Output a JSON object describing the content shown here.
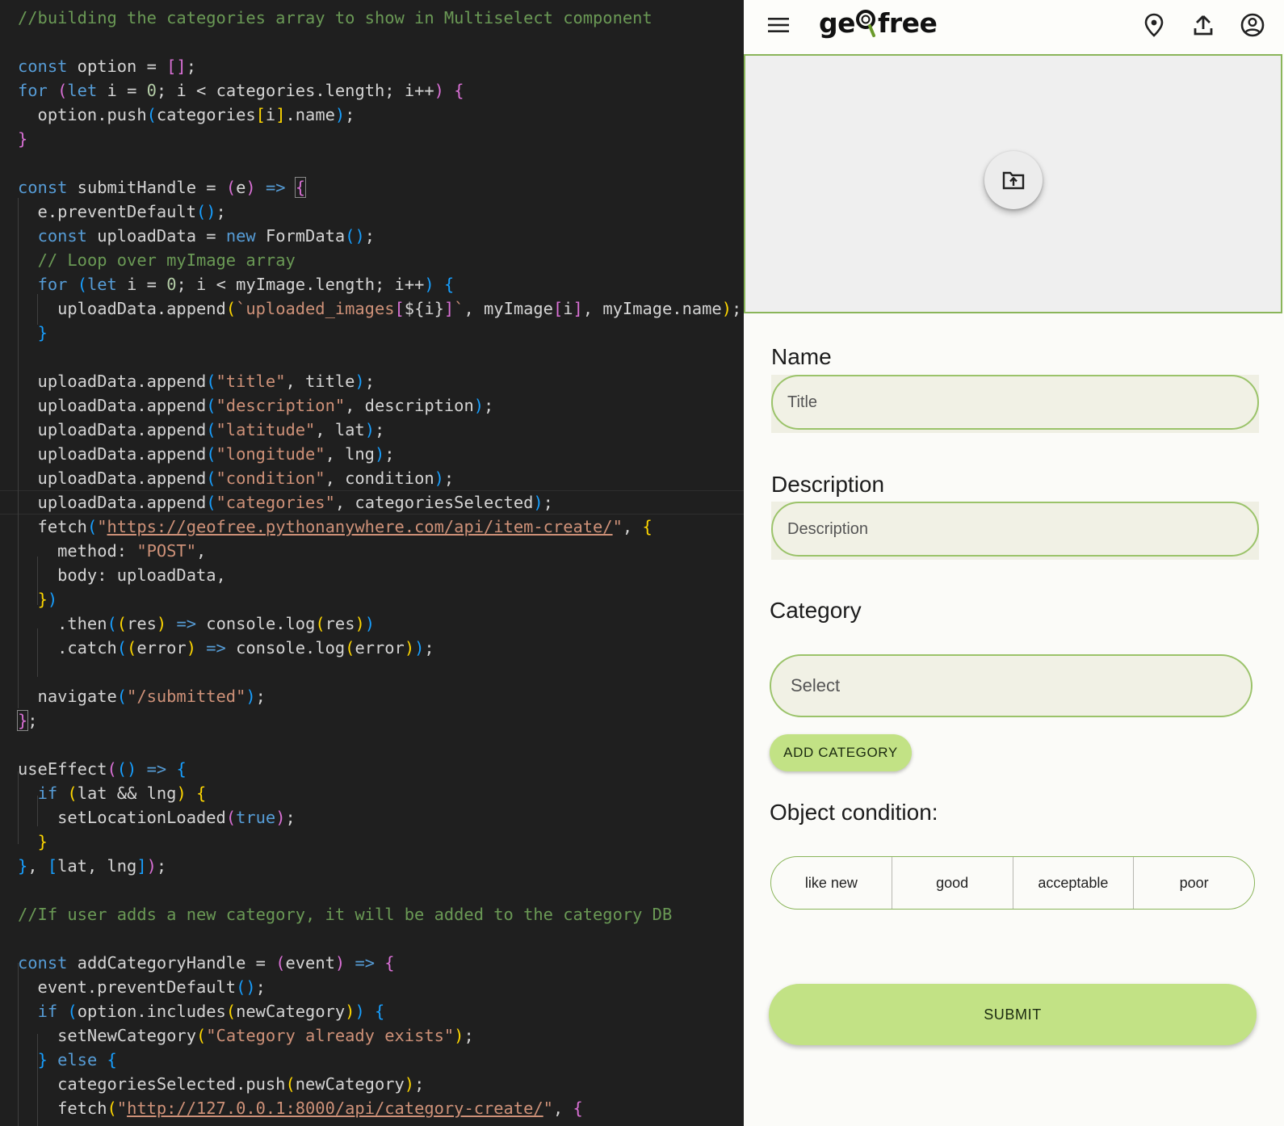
{
  "editor": {
    "code_lines": [
      [
        {
          "t": "//building the categories array to show in Multiselect component",
          "c": "c"
        }
      ],
      [],
      [
        {
          "t": "const",
          "c": "k"
        },
        {
          "t": " option = "
        },
        {
          "t": "[]",
          "c": "b2"
        },
        {
          "t": ";"
        }
      ],
      [
        {
          "t": "for",
          "c": "k"
        },
        {
          "t": " "
        },
        {
          "t": "(",
          "c": "b2"
        },
        {
          "t": "let",
          "c": "k"
        },
        {
          "t": " i = "
        },
        {
          "t": "0",
          "c": "n"
        },
        {
          "t": "; i < categories.length; i++"
        },
        {
          "t": ")",
          "c": "b2"
        },
        {
          "t": " "
        },
        {
          "t": "{",
          "c": "b2"
        }
      ],
      [
        {
          "t": "  option.push"
        },
        {
          "t": "(",
          "c": "b3"
        },
        {
          "t": "categories"
        },
        {
          "t": "[",
          "c": "b1"
        },
        {
          "t": "i"
        },
        {
          "t": "]",
          "c": "b1"
        },
        {
          "t": ".name"
        },
        {
          "t": ")",
          "c": "b3"
        },
        {
          "t": ";"
        }
      ],
      [
        {
          "t": "}",
          "c": "b2"
        }
      ],
      [],
      [
        {
          "t": "const",
          "c": "k"
        },
        {
          "t": " submitHandle = "
        },
        {
          "t": "(",
          "c": "b2"
        },
        {
          "t": "e"
        },
        {
          "t": ")",
          "c": "b2"
        },
        {
          "t": " "
        },
        {
          "t": "=>",
          "c": "k"
        },
        {
          "t": " "
        },
        {
          "t": "{",
          "c": "b2",
          "box": true
        }
      ],
      [
        {
          "t": "  e.preventDefault"
        },
        {
          "t": "()",
          "c": "b3"
        },
        {
          "t": ";"
        }
      ],
      [
        {
          "t": "  "
        },
        {
          "t": "const",
          "c": "k"
        },
        {
          "t": " uploadData = "
        },
        {
          "t": "new",
          "c": "k"
        },
        {
          "t": " FormData"
        },
        {
          "t": "()",
          "c": "b3"
        },
        {
          "t": ";"
        }
      ],
      [
        {
          "t": "  "
        },
        {
          "t": "// Loop over myImage array",
          "c": "c"
        }
      ],
      [
        {
          "t": "  "
        },
        {
          "t": "for",
          "c": "k"
        },
        {
          "t": " "
        },
        {
          "t": "(",
          "c": "b3"
        },
        {
          "t": "let",
          "c": "k"
        },
        {
          "t": " i = "
        },
        {
          "t": "0",
          "c": "n"
        },
        {
          "t": "; i < myImage.length; i++"
        },
        {
          "t": ")",
          "c": "b3"
        },
        {
          "t": " "
        },
        {
          "t": "{",
          "c": "b3"
        }
      ],
      [
        {
          "t": "    uploadData.append"
        },
        {
          "t": "(",
          "c": "b1"
        },
        {
          "t": "`uploaded_images",
          "c": "s"
        },
        {
          "t": "[",
          "c": "b2"
        },
        {
          "t": "${i}",
          "c": "e"
        },
        {
          "t": "]",
          "c": "b2"
        },
        {
          "t": "`",
          "c": "s"
        },
        {
          "t": ", myImage"
        },
        {
          "t": "[",
          "c": "b2"
        },
        {
          "t": "i"
        },
        {
          "t": "]",
          "c": "b2"
        },
        {
          "t": ", myImage.name"
        },
        {
          "t": ")",
          "c": "b1"
        },
        {
          "t": ";"
        }
      ],
      [
        {
          "t": "  "
        },
        {
          "t": "}",
          "c": "b3"
        }
      ],
      [],
      [
        {
          "t": "  uploadData.append"
        },
        {
          "t": "(",
          "c": "b3"
        },
        {
          "t": "\"title\"",
          "c": "s"
        },
        {
          "t": ", title"
        },
        {
          "t": ")",
          "c": "b3"
        },
        {
          "t": ";"
        }
      ],
      [
        {
          "t": "  uploadData.append"
        },
        {
          "t": "(",
          "c": "b3"
        },
        {
          "t": "\"description\"",
          "c": "s"
        },
        {
          "t": ", description"
        },
        {
          "t": ")",
          "c": "b3"
        },
        {
          "t": ";"
        }
      ],
      [
        {
          "t": "  uploadData.append"
        },
        {
          "t": "(",
          "c": "b3"
        },
        {
          "t": "\"latitude\"",
          "c": "s"
        },
        {
          "t": ", lat"
        },
        {
          "t": ")",
          "c": "b3"
        },
        {
          "t": ";"
        }
      ],
      [
        {
          "t": "  uploadData.append"
        },
        {
          "t": "(",
          "c": "b3"
        },
        {
          "t": "\"longitude\"",
          "c": "s"
        },
        {
          "t": ", lng"
        },
        {
          "t": ")",
          "c": "b3"
        },
        {
          "t": ";"
        }
      ],
      [
        {
          "t": "  uploadData.append"
        },
        {
          "t": "(",
          "c": "b3"
        },
        {
          "t": "\"condition\"",
          "c": "s"
        },
        {
          "t": ", condition"
        },
        {
          "t": ")",
          "c": "b3"
        },
        {
          "t": ";"
        }
      ],
      [
        {
          "t": "  uploadData.append"
        },
        {
          "t": "(",
          "c": "b3"
        },
        {
          "t": "\"categories\"",
          "c": "s"
        },
        {
          "t": ", categoriesSelected"
        },
        {
          "t": ")",
          "c": "b3"
        },
        {
          "t": ";"
        }
      ],
      [
        {
          "t": "  fetch"
        },
        {
          "t": "(",
          "c": "b3"
        },
        {
          "t": "\"",
          "c": "s"
        },
        {
          "t": "https://geofree.pythonanywhere.com/api/item-create/",
          "c": "u"
        },
        {
          "t": "\"",
          "c": "s"
        },
        {
          "t": ", "
        },
        {
          "t": "{",
          "c": "b1"
        }
      ],
      [
        {
          "t": "    method: "
        },
        {
          "t": "\"POST\"",
          "c": "s"
        },
        {
          "t": ","
        }
      ],
      [
        {
          "t": "    body: uploadData,"
        }
      ],
      [
        {
          "t": "  "
        },
        {
          "t": "}",
          "c": "b1"
        },
        {
          "t": ")",
          "c": "b3"
        }
      ],
      [
        {
          "t": "    .then"
        },
        {
          "t": "(",
          "c": "b3"
        },
        {
          "t": "(",
          "c": "b1"
        },
        {
          "t": "res"
        },
        {
          "t": ")",
          "c": "b1"
        },
        {
          "t": " "
        },
        {
          "t": "=>",
          "c": "k"
        },
        {
          "t": " console.log"
        },
        {
          "t": "(",
          "c": "b1"
        },
        {
          "t": "res"
        },
        {
          "t": ")",
          "c": "b1"
        },
        {
          "t": ")",
          "c": "b3"
        }
      ],
      [
        {
          "t": "    .catch"
        },
        {
          "t": "(",
          "c": "b3"
        },
        {
          "t": "(",
          "c": "b1"
        },
        {
          "t": "error"
        },
        {
          "t": ")",
          "c": "b1"
        },
        {
          "t": " "
        },
        {
          "t": "=>",
          "c": "k"
        },
        {
          "t": " console.log"
        },
        {
          "t": "(",
          "c": "b1"
        },
        {
          "t": "error"
        },
        {
          "t": ")",
          "c": "b1"
        },
        {
          "t": ")",
          "c": "b3"
        },
        {
          "t": ";"
        }
      ],
      [],
      [
        {
          "t": "  navigate"
        },
        {
          "t": "(",
          "c": "b3"
        },
        {
          "t": "\"/submitted\"",
          "c": "s"
        },
        {
          "t": ")",
          "c": "b3"
        },
        {
          "t": ";"
        }
      ],
      [
        {
          "t": "}",
          "c": "b2",
          "box": true
        },
        {
          "t": ";"
        }
      ],
      [],
      [
        {
          "t": "useEffect"
        },
        {
          "t": "(",
          "c": "b2"
        },
        {
          "t": "()",
          "c": "b3"
        },
        {
          "t": " "
        },
        {
          "t": "=>",
          "c": "k"
        },
        {
          "t": " "
        },
        {
          "t": "{",
          "c": "b3"
        }
      ],
      [
        {
          "t": "  "
        },
        {
          "t": "if",
          "c": "k"
        },
        {
          "t": " "
        },
        {
          "t": "(",
          "c": "b1"
        },
        {
          "t": "lat && lng"
        },
        {
          "t": ")",
          "c": "b1"
        },
        {
          "t": " "
        },
        {
          "t": "{",
          "c": "b1"
        }
      ],
      [
        {
          "t": "    setLocationLoaded"
        },
        {
          "t": "(",
          "c": "b2"
        },
        {
          "t": "true",
          "c": "k"
        },
        {
          "t": ")",
          "c": "b2"
        },
        {
          "t": ";"
        }
      ],
      [
        {
          "t": "  "
        },
        {
          "t": "}",
          "c": "b1"
        }
      ],
      [
        {
          "t": "}",
          "c": "b3"
        },
        {
          "t": ", "
        },
        {
          "t": "[",
          "c": "b3"
        },
        {
          "t": "lat, lng"
        },
        {
          "t": "]",
          "c": "b3"
        },
        {
          "t": ")",
          "c": "b2"
        },
        {
          "t": ";"
        }
      ],
      [],
      [
        {
          "t": "//If user adds a new category, it will be added to the category DB",
          "c": "c"
        }
      ],
      [],
      [
        {
          "t": "const",
          "c": "k"
        },
        {
          "t": " addCategoryHandle = "
        },
        {
          "t": "(",
          "c": "b2"
        },
        {
          "t": "event"
        },
        {
          "t": ")",
          "c": "b2"
        },
        {
          "t": " "
        },
        {
          "t": "=>",
          "c": "k"
        },
        {
          "t": " "
        },
        {
          "t": "{",
          "c": "b2"
        }
      ],
      [
        {
          "t": "  event.preventDefault"
        },
        {
          "t": "()",
          "c": "b3"
        },
        {
          "t": ";"
        }
      ],
      [
        {
          "t": "  "
        },
        {
          "t": "if",
          "c": "k"
        },
        {
          "t": " "
        },
        {
          "t": "(",
          "c": "b3"
        },
        {
          "t": "option.includes"
        },
        {
          "t": "(",
          "c": "b1"
        },
        {
          "t": "newCategory"
        },
        {
          "t": ")",
          "c": "b1"
        },
        {
          "t": ")",
          "c": "b3"
        },
        {
          "t": " "
        },
        {
          "t": "{",
          "c": "b3"
        }
      ],
      [
        {
          "t": "    setNewCategory"
        },
        {
          "t": "(",
          "c": "b1"
        },
        {
          "t": "\"Category already exists\"",
          "c": "s"
        },
        {
          "t": ")",
          "c": "b1"
        },
        {
          "t": ";"
        }
      ],
      [
        {
          "t": "  "
        },
        {
          "t": "}",
          "c": "b3"
        },
        {
          "t": " "
        },
        {
          "t": "else",
          "c": "k"
        },
        {
          "t": " "
        },
        {
          "t": "{",
          "c": "b3"
        }
      ],
      [
        {
          "t": "    categoriesSelected.push"
        },
        {
          "t": "(",
          "c": "b1"
        },
        {
          "t": "newCategory"
        },
        {
          "t": ")",
          "c": "b1"
        },
        {
          "t": ";"
        }
      ],
      [
        {
          "t": "    fetch"
        },
        {
          "t": "(",
          "c": "b1"
        },
        {
          "t": "\"",
          "c": "s"
        },
        {
          "t": "http://127.0.0.1:8000/api/category-create/",
          "c": "u"
        },
        {
          "t": "\"",
          "c": "s"
        },
        {
          "t": ", "
        },
        {
          "t": "{",
          "c": "b2"
        }
      ]
    ]
  },
  "app": {
    "logo": {
      "left": "ge",
      "right": "free"
    },
    "header_icons": [
      "menu-icon",
      "location-pin-icon",
      "upload-icon",
      "account-circle-icon"
    ],
    "upload": {
      "icon": "folder-upload-icon"
    },
    "name": {
      "label": "Name",
      "placeholder": "Title",
      "value": ""
    },
    "description": {
      "label": "Description",
      "placeholder": "Description",
      "value": ""
    },
    "category": {
      "label": "Category",
      "placeholder": "Select"
    },
    "add_category_label": "ADD CATEGORY",
    "condition": {
      "label": "Object condition:",
      "options": [
        "like new",
        "good",
        "acceptable",
        "poor"
      ]
    },
    "submit_label": "SUBMIT"
  },
  "colors": {
    "editor_bg": "#1f1f1f",
    "app_bg": "#fbfbf8",
    "accent_green": "#c2e285",
    "border_green": "#9bc36a",
    "field_fill": "#f1f1e5"
  }
}
